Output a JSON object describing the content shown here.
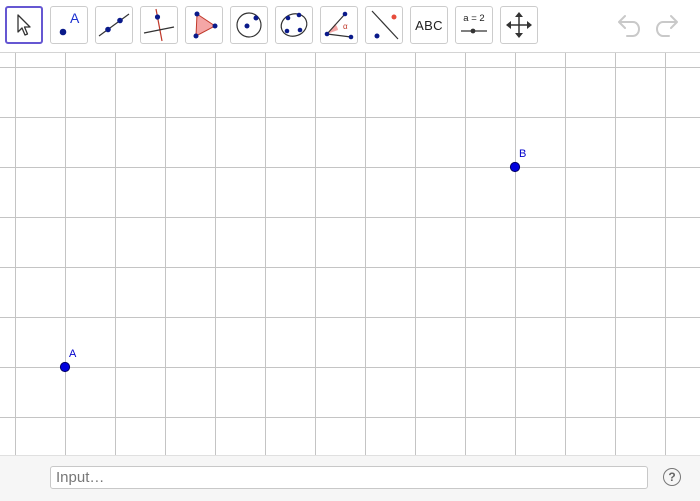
{
  "toolbar": {
    "tools": [
      {
        "icon": "move-arrow-icon",
        "active": true
      },
      {
        "icon": "point-icon",
        "label": "A"
      },
      {
        "icon": "line-icon"
      },
      {
        "icon": "perpendicular-line-icon"
      },
      {
        "icon": "polygon-icon"
      },
      {
        "icon": "circle-center-point-icon"
      },
      {
        "icon": "conic-five-points-icon"
      },
      {
        "icon": "angle-icon",
        "label": "α"
      },
      {
        "icon": "reflect-about-line-icon"
      },
      {
        "icon": "text-icon",
        "label": "ABC"
      },
      {
        "icon": "slider-icon",
        "label": "a = 2"
      },
      {
        "icon": "move-graphics-view-icon"
      }
    ],
    "undo_icon": "undo-icon",
    "redo_icon": "redo-icon"
  },
  "graphics": {
    "points": [
      {
        "name": "A",
        "color": "#0000cc"
      },
      {
        "name": "B",
        "color": "#0000cc"
      }
    ],
    "grid_color": "#c0c0c0"
  },
  "input_bar": {
    "placeholder": "Input…",
    "help_label": "?"
  },
  "colors": {
    "accent": "#6557d2",
    "point_fill": "#0000dd",
    "polygon_fill": "#f4a6a6"
  }
}
